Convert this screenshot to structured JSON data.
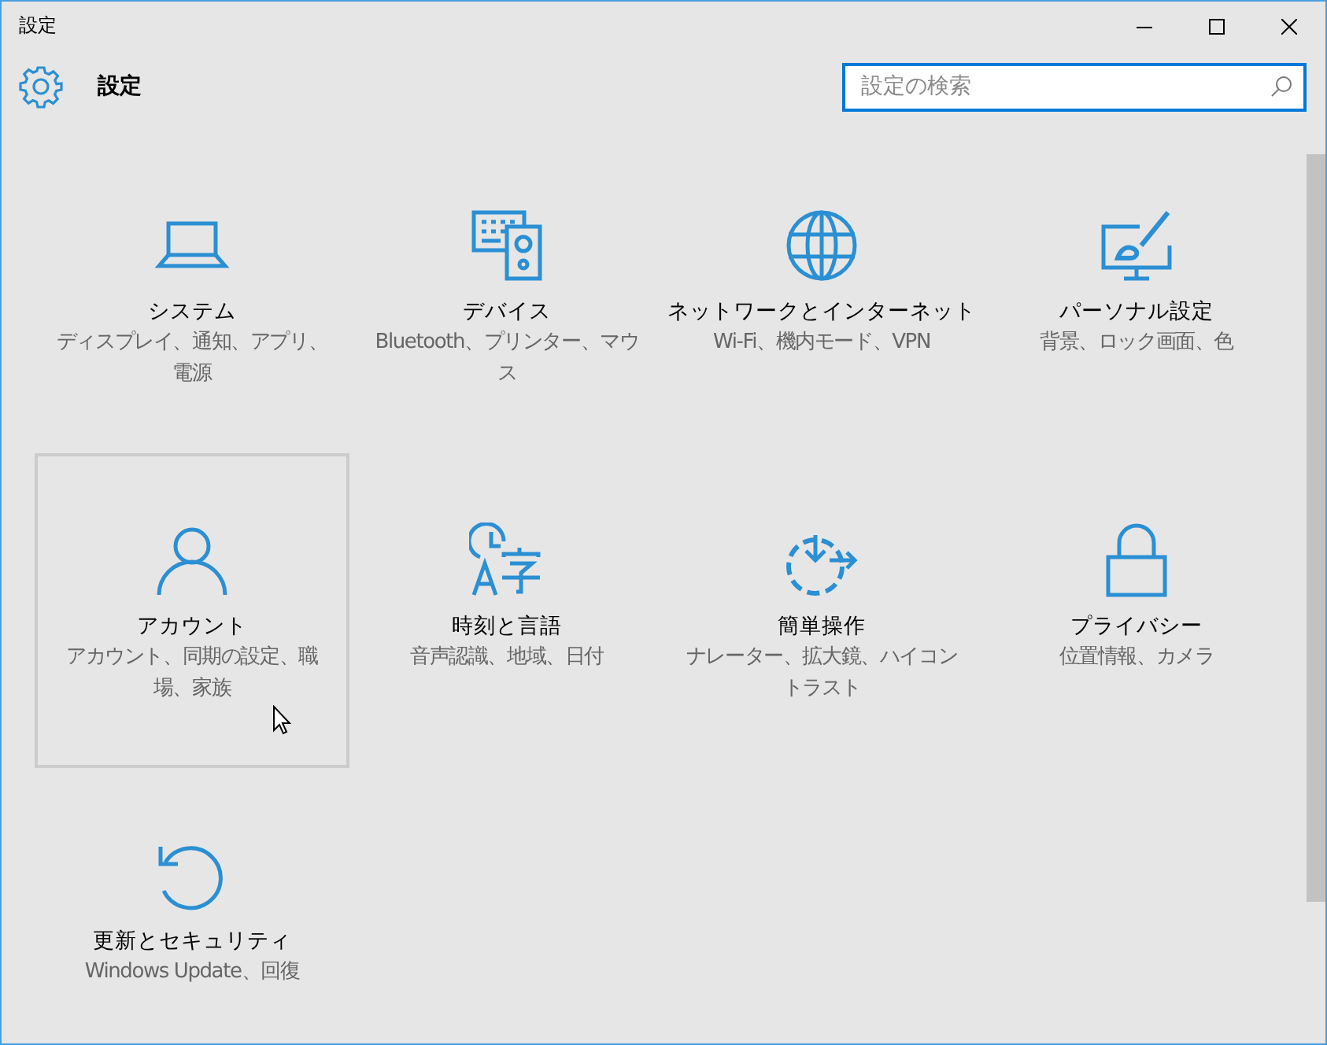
{
  "window": {
    "title": "設定"
  },
  "header": {
    "title": "設定"
  },
  "search": {
    "placeholder": "設定の検索"
  },
  "tiles": [
    {
      "kind": "system",
      "title": "システム",
      "subtitle": "ディスプレイ、通知、アプリ、電源",
      "hovered": false
    },
    {
      "kind": "devices",
      "title": "デバイス",
      "subtitle": "Bluetooth、プリンター、マウス",
      "hovered": false
    },
    {
      "kind": "network",
      "title": "ネットワークとインターネット",
      "subtitle": "Wi-Fi、機内モード、VPN",
      "hovered": false
    },
    {
      "kind": "personalization",
      "title": "パーソナル設定",
      "subtitle": "背景、ロック画面、色",
      "hovered": false
    },
    {
      "kind": "accounts",
      "title": "アカウント",
      "subtitle": "アカウント、同期の設定、職場、家族",
      "hovered": true
    },
    {
      "kind": "time",
      "title": "時刻と言語",
      "subtitle": "音声認識、地域、日付",
      "hovered": false
    },
    {
      "kind": "ease",
      "title": "簡単操作",
      "subtitle": "ナレーター、拡大鏡、ハイコントラスト",
      "hovered": false
    },
    {
      "kind": "privacy",
      "title": "プライバシー",
      "subtitle": "位置情報、カメラ",
      "hovered": false
    },
    {
      "kind": "update",
      "title": "更新とセキュリティ",
      "subtitle": "Windows Update、回復",
      "hovered": false
    }
  ]
}
